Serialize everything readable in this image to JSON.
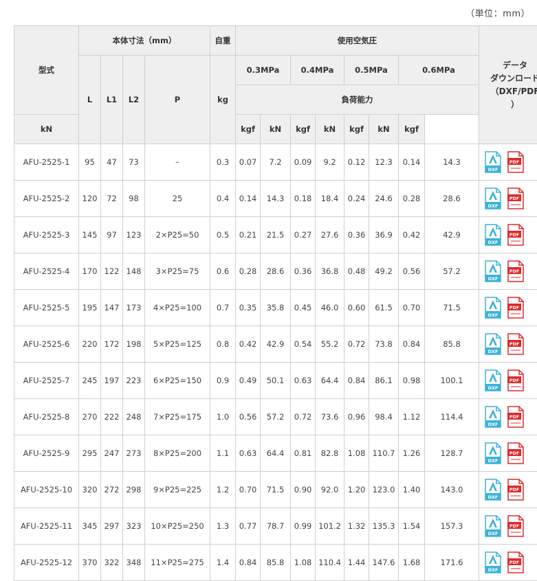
{
  "unit_note": "（単位：mm）",
  "headers": {
    "model": "型式",
    "body_dims": "本体寸法（mm）",
    "weight": "自重",
    "air_pressure": "使用空気圧",
    "download_line1": "データ",
    "download_line2": "ダウンロード",
    "download_line3": "（DXF/PDF",
    "download_line4": "）",
    "L": "L",
    "L1": "L1",
    "L2": "L2",
    "P": "P",
    "kg": "kg",
    "p03": "0.3MPa",
    "p04": "0.4MPa",
    "p05": "0.5MPa",
    "p06": "0.6MPa",
    "load_capacity": "負荷能力",
    "kN": "kN",
    "kgf": "kgf"
  },
  "icons": {
    "dxf": "dxf-file-icon",
    "pdf": "pdf-file-icon",
    "dxf_color": "#3bb2d9",
    "pdf_color": "#e0282a"
  },
  "rows": [
    {
      "model": "AFU-2525-1",
      "L": "95",
      "L1": "47",
      "L2": "73",
      "P": "–",
      "kg": "0.3",
      "kn03": "0.07",
      "kgf03": "7.2",
      "kn04": "0.09",
      "kgf04": "9.2",
      "kn05": "0.12",
      "kgf05": "12.3",
      "kn06": "0.14",
      "kgf06": "14.3"
    },
    {
      "model": "AFU-2525-2",
      "L": "120",
      "L1": "72",
      "L2": "98",
      "P": "25",
      "kg": "0.4",
      "kn03": "0.14",
      "kgf03": "14.3",
      "kn04": "0.18",
      "kgf04": "18.4",
      "kn05": "0.24",
      "kgf05": "24.6",
      "kn06": "0.28",
      "kgf06": "28.6"
    },
    {
      "model": "AFU-2525-3",
      "L": "145",
      "L1": "97",
      "L2": "123",
      "P": "2×P25=50",
      "kg": "0.5",
      "kn03": "0.21",
      "kgf03": "21.5",
      "kn04": "0.27",
      "kgf04": "27.6",
      "kn05": "0.36",
      "kgf05": "36.9",
      "kn06": "0.42",
      "kgf06": "42.9"
    },
    {
      "model": "AFU-2525-4",
      "L": "170",
      "L1": "122",
      "L2": "148",
      "P": "3×P25=75",
      "kg": "0.6",
      "kn03": "0.28",
      "kgf03": "28.6",
      "kn04": "0.36",
      "kgf04": "36.8",
      "kn05": "0.48",
      "kgf05": "49.2",
      "kn06": "0.56",
      "kgf06": "57.2"
    },
    {
      "model": "AFU-2525-5",
      "L": "195",
      "L1": "147",
      "L2": "173",
      "P": "4×P25=100",
      "kg": "0.7",
      "kn03": "0.35",
      "kgf03": "35.8",
      "kn04": "0.45",
      "kgf04": "46.0",
      "kn05": "0.60",
      "kgf05": "61.5",
      "kn06": "0.70",
      "kgf06": "71.5"
    },
    {
      "model": "AFU-2525-6",
      "L": "220",
      "L1": "172",
      "L2": "198",
      "P": "5×P25=125",
      "kg": "0.8",
      "kn03": "0.42",
      "kgf03": "42.9",
      "kn04": "0.54",
      "kgf04": "55.2",
      "kn05": "0.72",
      "kgf05": "73.8",
      "kn06": "0.84",
      "kgf06": "85.8"
    },
    {
      "model": "AFU-2525-7",
      "L": "245",
      "L1": "197",
      "L2": "223",
      "P": "6×P25=150",
      "kg": "0.9",
      "kn03": "0.49",
      "kgf03": "50.1",
      "kn04": "0.63",
      "kgf04": "64.4",
      "kn05": "0.84",
      "kgf05": "86.1",
      "kn06": "0.98",
      "kgf06": "100.1"
    },
    {
      "model": "AFU-2525-8",
      "L": "270",
      "L1": "222",
      "L2": "248",
      "P": "7×P25=175",
      "kg": "1.0",
      "kn03": "0.56",
      "kgf03": "57.2",
      "kn04": "0.72",
      "kgf04": "73.6",
      "kn05": "0.96",
      "kgf05": "98.4",
      "kn06": "1.12",
      "kgf06": "114.4"
    },
    {
      "model": "AFU-2525-9",
      "L": "295",
      "L1": "247",
      "L2": "273",
      "P": "8×P25=200",
      "kg": "1.1",
      "kn03": "0.63",
      "kgf03": "64.4",
      "kn04": "0.81",
      "kgf04": "82.8",
      "kn05": "1.08",
      "kgf05": "110.7",
      "kn06": "1.26",
      "kgf06": "128.7"
    },
    {
      "model": "AFU-2525-10",
      "L": "320",
      "L1": "272",
      "L2": "298",
      "P": "9×P25=225",
      "kg": "1.2",
      "kn03": "0.70",
      "kgf03": "71.5",
      "kn04": "0.90",
      "kgf04": "92.0",
      "kn05": "1.20",
      "kgf05": "123.0",
      "kn06": "1.40",
      "kgf06": "143.0"
    },
    {
      "model": "AFU-2525-11",
      "L": "345",
      "L1": "297",
      "L2": "323",
      "P": "10×P25=250",
      "kg": "1.3",
      "kn03": "0.77",
      "kgf03": "78.7",
      "kn04": "0.99",
      "kgf04": "101.2",
      "kn05": "1.32",
      "kgf05": "135.3",
      "kn06": "1.54",
      "kgf06": "157.3"
    },
    {
      "model": "AFU-2525-12",
      "L": "370",
      "L1": "322",
      "L2": "348",
      "P": "11×P25=275",
      "kg": "1.4",
      "kn03": "0.84",
      "kgf03": "85.8",
      "kn04": "1.08",
      "kgf04": "110.4",
      "kn05": "1.44",
      "kgf05": "147.6",
      "kn06": "1.68",
      "kgf06": "171.6"
    }
  ]
}
